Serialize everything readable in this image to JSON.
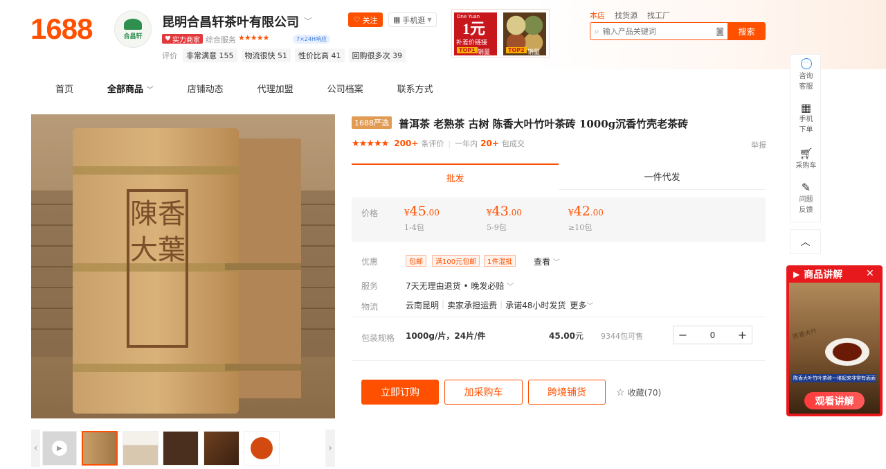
{
  "header": {
    "logo": "1688",
    "shop_avatar_text": "合昌轩",
    "shop_name": "昆明合昌轩茶叶有限公司",
    "follow_label": "关注",
    "mobile_label": "手机逛",
    "power_badge": "实力商家",
    "service_label": "综合服务",
    "service_stars": "★★★★★",
    "badge_24h": "7×24H响应",
    "eval_label": "评价",
    "eval_chips": [
      {
        "text": "非常满意",
        "count": "155"
      },
      {
        "text": "物流很快",
        "count": "51"
      },
      {
        "text": "性价比高",
        "count": "41"
      },
      {
        "text": "回购很多次",
        "count": "39"
      }
    ],
    "promo1": {
      "line1": "One Yuan",
      "big": "1元",
      "line2": "补差价链接",
      "tag": "TOP1",
      "tag2": "销量"
    },
    "promo2": {
      "tag": "TOP2",
      "tag2": "销量"
    }
  },
  "search": {
    "tabs": [
      "本店",
      "找货源",
      "找工厂"
    ],
    "placeholder": "输入产品关键词",
    "button": "搜索"
  },
  "nav": {
    "items": [
      "首页",
      "全部商品",
      "店铺动态",
      "代理加盟",
      "公司档案",
      "联系方式"
    ]
  },
  "product": {
    "tag": "1688严选",
    "title": "普洱茶 老熟茶 古树 陈香大叶竹叶茶砖 1000g沉香竹壳老茶砖",
    "rating_stars": "★★★★★",
    "reviews_count": "200+",
    "reviews_label": "条评价",
    "sales_prefix": "一年内",
    "sales_count": "20+",
    "sales_label": "包成交",
    "report": "举报",
    "brick_text": "陳香大葉",
    "tabs": {
      "wholesale": "批发",
      "dropship": "一件代发"
    },
    "price_label": "价格",
    "price_tiers": [
      {
        "cur": "¥",
        "int": "45",
        "dec": ".00",
        "qty": "1-4包"
      },
      {
        "cur": "¥",
        "int": "43",
        "dec": ".00",
        "qty": "5-9包"
      },
      {
        "cur": "¥",
        "int": "42",
        "dec": ".00",
        "qty": "≥10包"
      }
    ],
    "promo_label": "优惠",
    "coupons": [
      "包邮",
      "满100元包邮",
      "1件混批"
    ],
    "view_more": "查看",
    "service_label": "服务",
    "service_text": "7天无理由退货 • 晚发必赔",
    "logistics_label": "物流",
    "logistics": [
      "云南昆明",
      "卖家承担运费",
      "承诺48小时发货",
      "更多"
    ],
    "spec_label": "包装规格",
    "spec_value": "1000g/片，24片/件",
    "spec_price_num": "45.00",
    "spec_price_unit": "元",
    "spec_stock": "9344包可售",
    "quantity": "0",
    "buy_now": "立即订购",
    "add_cart": "加采购车",
    "cross_border": "跨境铺货",
    "favorite": "收藏(70)"
  },
  "sidebar": {
    "items": [
      {
        "l1": "咨询",
        "l2": "客服"
      },
      {
        "l1": "手机",
        "l2": "下单"
      },
      {
        "l1": "采购车",
        "l2": ""
      },
      {
        "l1": "问题",
        "l2": "反馈"
      }
    ]
  },
  "live": {
    "title": "商品讲解",
    "video_text": "陈香大叶",
    "caption": "陈香大叶竹叶茶砖一堆起来非常有面面",
    "button": "观看讲解"
  },
  "colors": {
    "accent": "#ff5000",
    "live_red": "#e8191c"
  }
}
